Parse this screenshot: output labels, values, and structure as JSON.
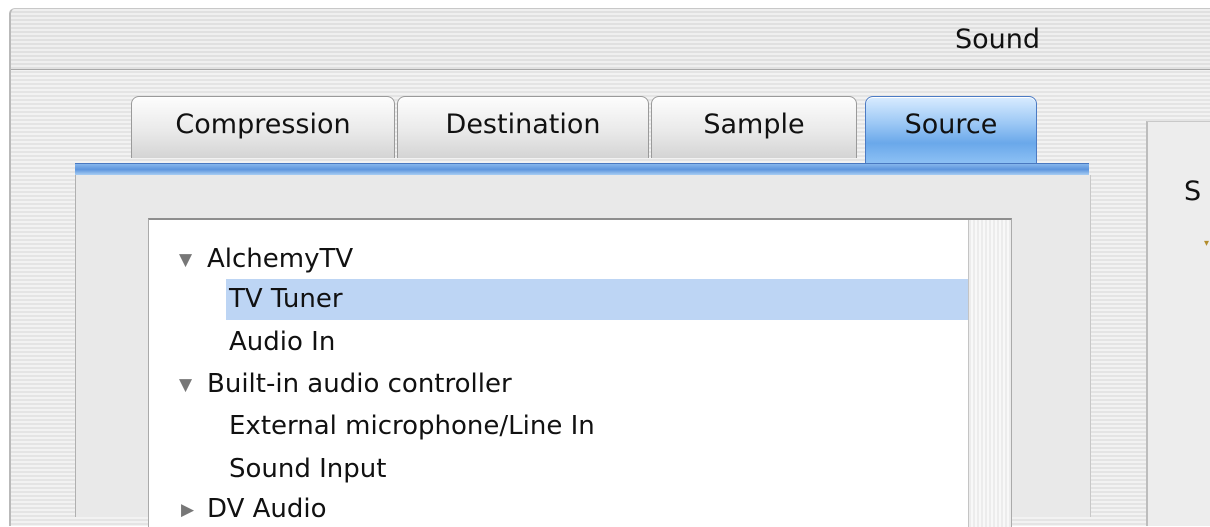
{
  "window": {
    "title": "Sound"
  },
  "tabs": [
    {
      "label": "Compression",
      "active": false
    },
    {
      "label": "Destination",
      "active": false
    },
    {
      "label": "Sample",
      "active": false
    },
    {
      "label": "Source",
      "active": true
    }
  ],
  "source_list": {
    "items": [
      {
        "label": "AlchemyTV",
        "level": 0,
        "expander": "▼",
        "expanded": true
      },
      {
        "label": "TV Tuner",
        "level": 1,
        "selected": true
      },
      {
        "label": "Audio In",
        "level": 1
      },
      {
        "label": "Built-in audio controller",
        "level": 0,
        "expander": "▼",
        "expanded": true
      },
      {
        "label": "External microphone/Line In",
        "level": 1
      },
      {
        "label": "Sound Input",
        "level": 1
      },
      {
        "label": "DV Audio",
        "level": 0,
        "expander": "▶",
        "expanded": false
      }
    ]
  },
  "side_panel": {
    "label": "S"
  },
  "colors": {
    "selection": "#bdd5f4",
    "active_tab": "#6aa8ea",
    "expander": "#777777"
  }
}
